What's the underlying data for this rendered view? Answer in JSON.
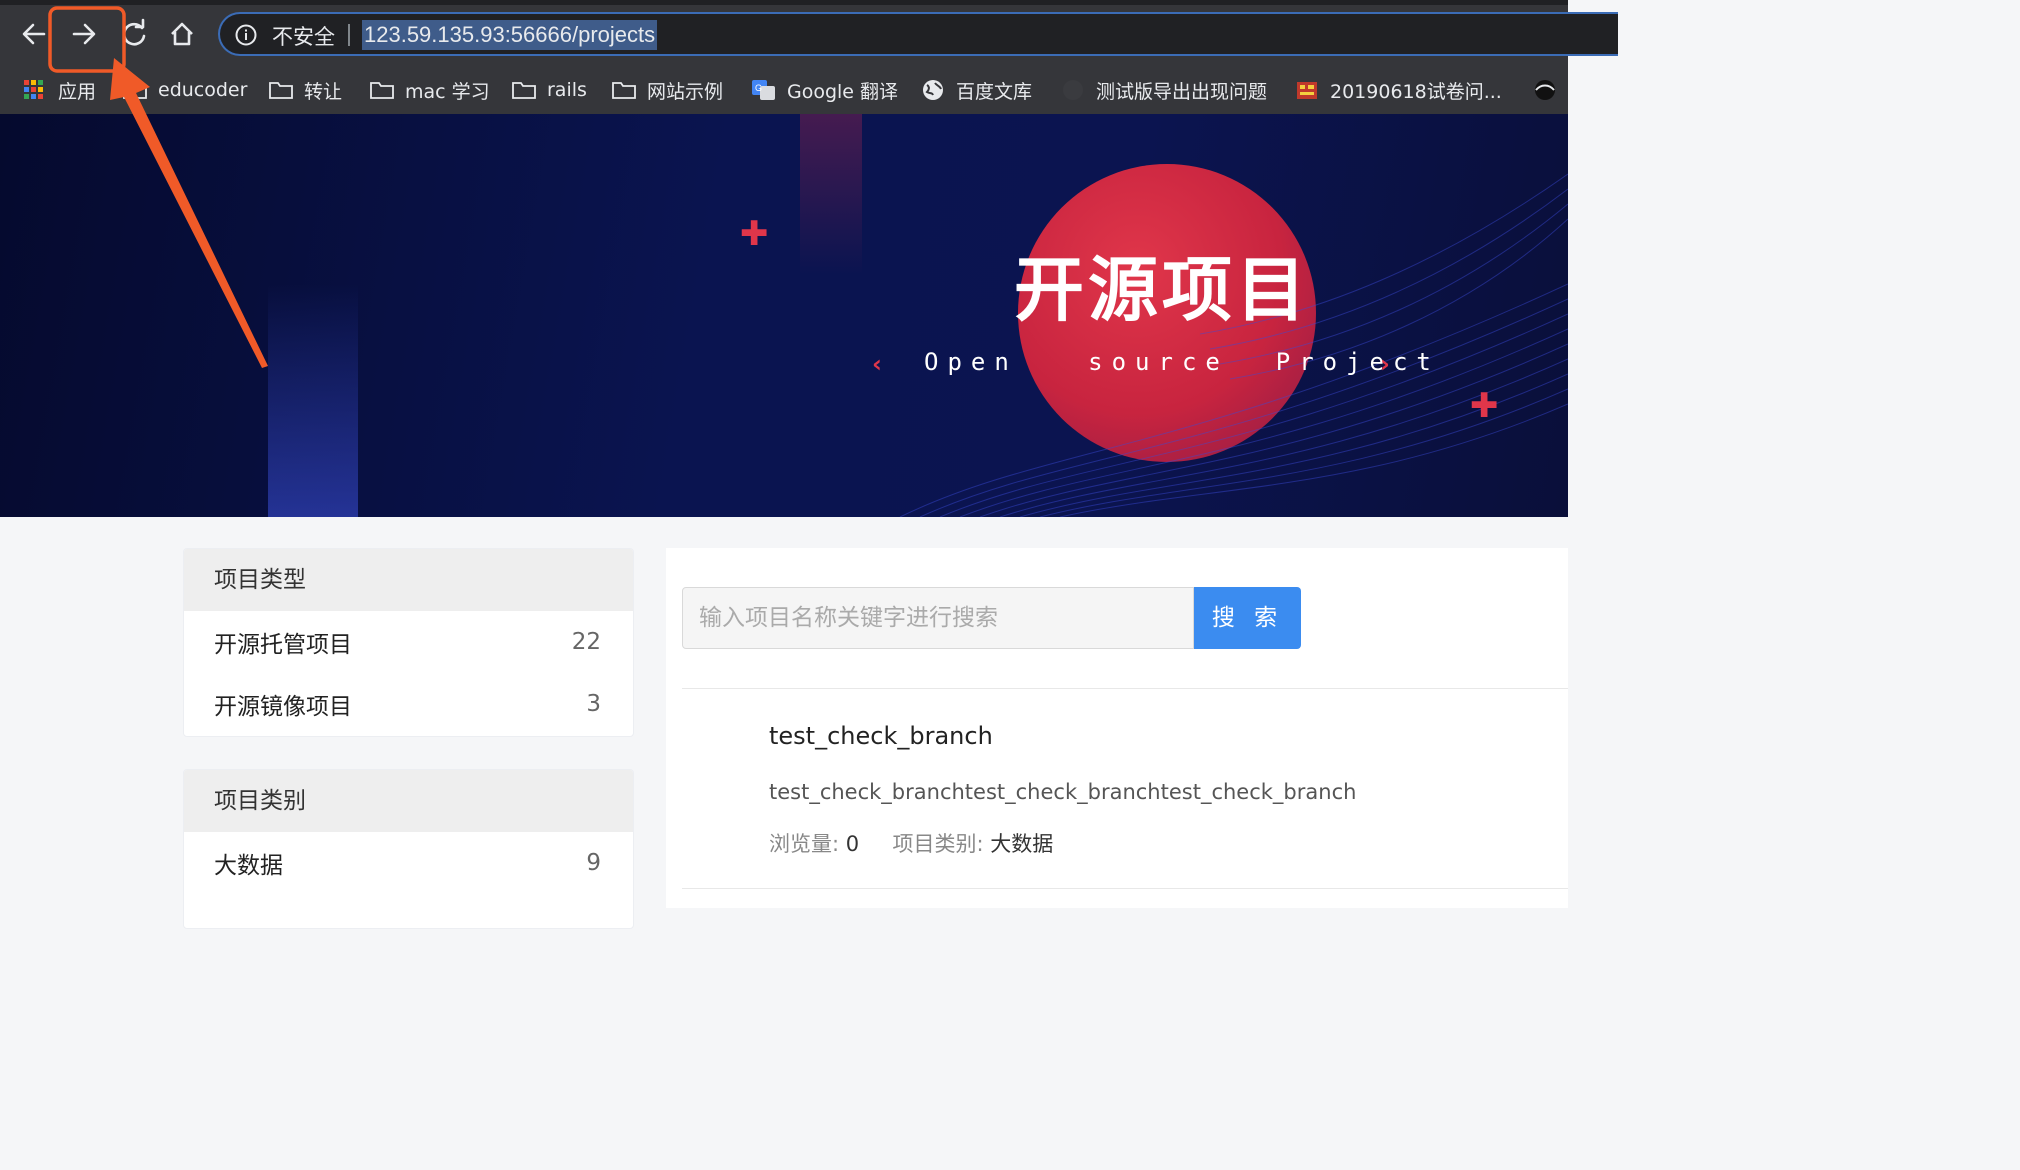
{
  "browser": {
    "security_label": "不安全",
    "url": "123.59.135.93:56666/projects",
    "bookmarks": [
      {
        "label": "应用",
        "icon": "apps-grid-icon"
      },
      {
        "label": "educoder",
        "icon": "folder-icon"
      },
      {
        "label": "转让",
        "icon": "folder-icon"
      },
      {
        "label": "mac 学习",
        "icon": "folder-icon"
      },
      {
        "label": "rails",
        "icon": "folder-icon"
      },
      {
        "label": "网站示例",
        "icon": "folder-icon"
      },
      {
        "label": "Google 翻译",
        "icon": "google-translate-icon"
      },
      {
        "label": "百度文库",
        "icon": "globe-icon"
      },
      {
        "label": "测试版导出出现问题",
        "icon": "github-icon"
      },
      {
        "label": "20190618试卷问...",
        "icon": "site-favicon-icon"
      }
    ]
  },
  "banner": {
    "title": "开源项目",
    "subtitle": "Open   source  Project",
    "chevron_left": "‹",
    "chevron_right": "›",
    "plus": "✚"
  },
  "sidebar": {
    "type_panel": {
      "title": "项目类型",
      "items": [
        {
          "label": "开源托管项目",
          "count": "22"
        },
        {
          "label": "开源镜像项目",
          "count": "3"
        }
      ]
    },
    "category_panel": {
      "title": "项目类别",
      "items": [
        {
          "label": "大数据",
          "count": "9"
        }
      ]
    }
  },
  "main": {
    "search": {
      "placeholder": "输入项目名称关键字进行搜索",
      "button_label": "搜 索"
    },
    "projects": [
      {
        "title": "test_check_branch",
        "description": "test_check_branchtest_check_branchtest_check_branch",
        "views_label": "浏览量:",
        "views": "0",
        "category_label": "项目类别:",
        "category": "大数据"
      }
    ]
  },
  "colors": {
    "accent": "#3b8cf0",
    "banner_bg": "#0a1450",
    "banner_red": "#e0364a",
    "annotation": "#f05a28"
  }
}
